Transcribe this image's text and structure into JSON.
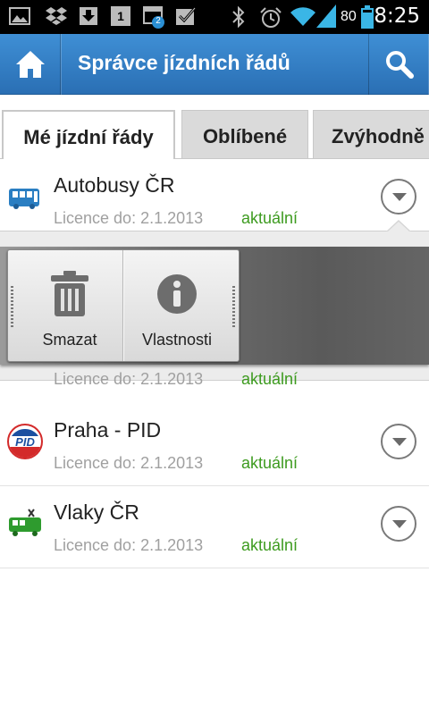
{
  "status_bar": {
    "time": "8:25",
    "battery_percent": "80",
    "notification_badge": "2",
    "calendar_day": "1",
    "icons": [
      "gallery-icon",
      "dropbox-icon",
      "download-icon",
      "calendar-icon",
      "notification-counter-icon",
      "checkbox-icon",
      "bluetooth-icon",
      "alarm-icon",
      "wifi-icon",
      "signal-icon"
    ]
  },
  "action_bar": {
    "title": "Správce jízdních řádů",
    "color": "#3380c7"
  },
  "tabs": [
    {
      "label": "Mé jízdní řády",
      "active": true
    },
    {
      "label": "Oblíbené",
      "active": false
    },
    {
      "label": "Zvýhodně",
      "active": false
    }
  ],
  "timetables": [
    {
      "name": "Autobusy ČR",
      "license": "Licence do: 2.1.2013",
      "status": "aktuální",
      "icon": "bus-icon"
    },
    {
      "name": "Praha - PID",
      "license": "Licence do: 2.1.2013",
      "status": "aktuální",
      "icon": "pid-logo-icon"
    },
    {
      "name": "Vlaky ČR",
      "license": "Licence do: 2.1.2013",
      "status": "aktuální",
      "icon": "train-icon"
    }
  ],
  "quick_actions": {
    "obscured_license": "Licence do: 2.1.2013",
    "obscured_status": "aktuální",
    "buttons": [
      {
        "label": "Smazat",
        "icon": "trash-icon"
      },
      {
        "label": "Vlastnosti",
        "icon": "info-icon"
      }
    ]
  },
  "colors": {
    "status_current": "#3d9b1f",
    "license_text": "#a0a0a0"
  }
}
